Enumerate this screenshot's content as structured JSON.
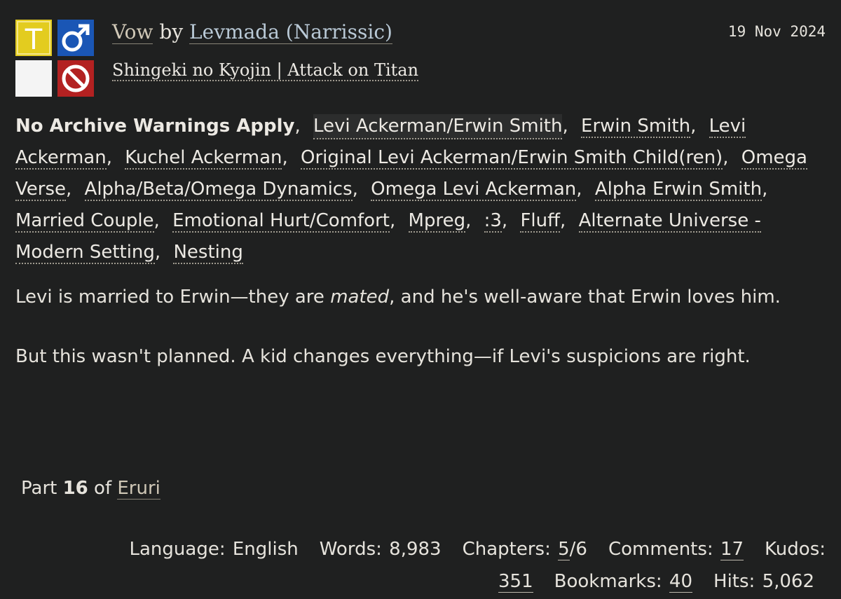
{
  "work": {
    "title": "Vow",
    "by": "by",
    "author": "Levmada (Narrissic)",
    "date": "19 Nov 2024",
    "fandom": "Shingeki no Kyojin | Attack on Titan",
    "icons": {
      "rating": {
        "name": "teen-rating-icon",
        "glyph": "T",
        "color": "#e3cc1f"
      },
      "category": {
        "name": "male-symbol-icon",
        "glyph": "♂",
        "color": "#1a56b5"
      },
      "warning": {
        "name": "no-warning-icon",
        "color": "#f4f4f4"
      },
      "complete": {
        "name": "prohibited-incomplete-icon",
        "color": "#b32121"
      }
    }
  },
  "tags": [
    {
      "label": "No Archive Warnings Apply"
    },
    {
      "label": "Levi Ackerman/Erwin Smith"
    },
    {
      "label": "Erwin Smith"
    },
    {
      "label": "Levi Ackerman"
    },
    {
      "label": "Kuchel Ackerman"
    },
    {
      "label": "Original Levi Ackerman/Erwin Smith Child(ren)"
    },
    {
      "label": "Omega Verse"
    },
    {
      "label": "Alpha/Beta/Omega Dynamics"
    },
    {
      "label": "Omega Levi Ackerman"
    },
    {
      "label": "Alpha Erwin Smith"
    },
    {
      "label": "Married Couple"
    },
    {
      "label": "Emotional Hurt/Comfort"
    },
    {
      "label": "Mpreg"
    },
    {
      "label": ":3"
    },
    {
      "label": "Fluff"
    },
    {
      "label": "Alternate Universe - Modern Setting"
    },
    {
      "label": "Nesting"
    }
  ],
  "summary": {
    "p1_before": "Levi is married to Erwin—they are ",
    "p1_em": "mated",
    "p1_after": ", and he's well-aware that Erwin loves him.",
    "p2": "But this wasn't planned. A kid changes everything—if Levi's suspicions are right."
  },
  "series": {
    "part_word": "Part",
    "part_number": "16",
    "of_word": "of",
    "name": "Eruri"
  },
  "stats": {
    "language_label": "Language:",
    "language": "English",
    "words_label": "Words:",
    "words": "8,983",
    "chapters_label": "Chapters:",
    "chapters_posted": "5",
    "chapters_total": "/6",
    "comments_label": "Comments:",
    "comments": "17",
    "kudos_label": "Kudos:",
    "kudos": "351",
    "bookmarks_label": "Bookmarks:",
    "bookmarks": "40",
    "hits_label": "Hits:",
    "hits": "5,062"
  }
}
